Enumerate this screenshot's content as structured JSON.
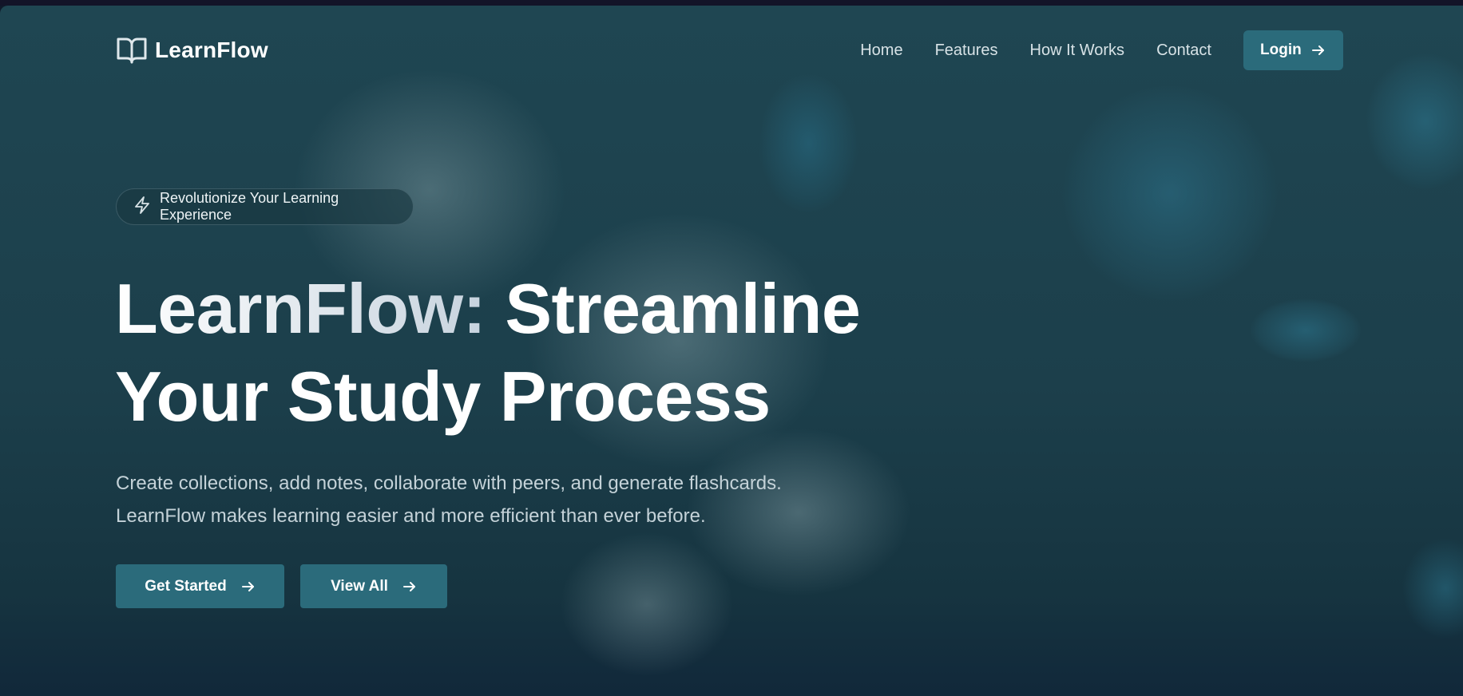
{
  "header": {
    "logo_text": "LearnFlow",
    "nav": [
      "Home",
      "Features",
      "How It Works",
      "Contact"
    ],
    "login_label": "Login"
  },
  "hero": {
    "badge": "Revolutionize Your Learning Experience",
    "title_brand": "LearnFlow:",
    "title_rest_line1": "Streamline",
    "title_line2": "Your Study Process",
    "description_line1": "Create collections, add notes, collaborate with peers, and generate flashcards.",
    "description_line2": "LearnFlow makes learning easier and more efficient than ever before.",
    "primary_cta": "Get Started",
    "secondary_cta": "View All"
  },
  "icons": {
    "logo": "book-open-icon",
    "badge": "lightning-icon",
    "cta": "arrow-right-icon"
  },
  "colors": {
    "accent": "#2b6b7b",
    "background": "#1f4652",
    "text_primary": "#ffffff",
    "text_secondary": "#c4d2d8"
  }
}
